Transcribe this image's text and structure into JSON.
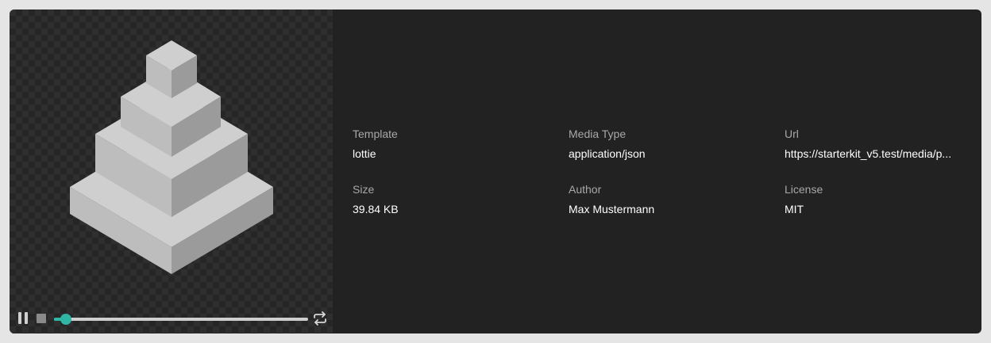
{
  "preview": {
    "icon": "isometric-pyramid-animation",
    "colors": {
      "top": "#cfcfcf",
      "left": "#bdbdbd",
      "right": "#9b9b9b",
      "accent": "#2fb6a5"
    }
  },
  "player": {
    "pause_icon": "pause-icon",
    "stop_icon": "stop-icon",
    "loop_icon": "loop-icon",
    "progress": 0.03
  },
  "meta": {
    "rows": [
      [
        {
          "label": "Template",
          "value": "lottie"
        },
        {
          "label": "Media Type",
          "value": "application/json"
        },
        {
          "label": "Url",
          "value": "https://starterkit_v5.test/media/p..."
        }
      ],
      [
        {
          "label": "Size",
          "value": "39.84 KB"
        },
        {
          "label": "Author",
          "value": "Max Mustermann"
        },
        {
          "label": "License",
          "value": "MIT"
        }
      ]
    ]
  }
}
